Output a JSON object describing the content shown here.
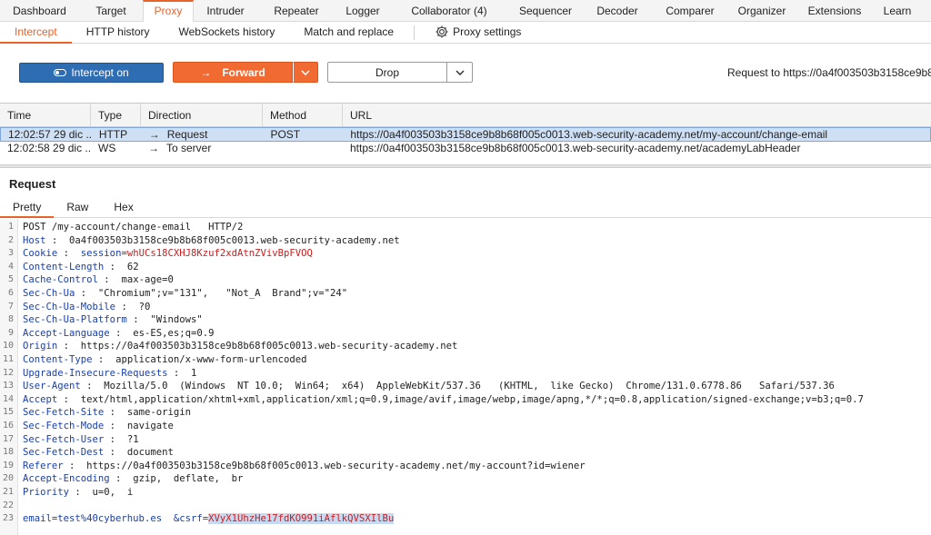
{
  "top_tabs": [
    "Dashboard",
    "Target",
    "Proxy",
    "Intruder",
    "Repeater",
    "Logger",
    "Collaborator (4)",
    "Sequencer",
    "Decoder",
    "Comparer",
    "Organizer",
    "Extensions",
    "Learn"
  ],
  "top_active": "Proxy",
  "sub_tabs": [
    "Intercept",
    "HTTP history",
    "WebSockets history",
    "Match and replace"
  ],
  "proxy_settings_label": "Proxy settings",
  "toolbar": {
    "intercept_label": "Intercept on",
    "forward_label": "Forward",
    "drop_label": "Drop",
    "request_to": "Request to https://0a4f003503b3158ce9b8"
  },
  "table": {
    "headers": [
      "Time",
      "Type",
      "Direction",
      "Method",
      "URL"
    ],
    "rows": [
      {
        "time": "12:02:57 29 dic ...",
        "type": "HTTP",
        "direction": "Request",
        "method": "POST",
        "url": "https://0a4f003503b3158ce9b8b68f005c0013.web-security-academy.net/my-account/change-email",
        "selected": true
      },
      {
        "time": "12:02:58 29 dic ...",
        "type": "WS",
        "direction": "To server",
        "method": "",
        "url": "https://0a4f003503b3158ce9b8b68f005c0013.web-security-academy.net/academyLabHeader",
        "selected": false
      }
    ]
  },
  "request": {
    "title": "Request",
    "tabs": [
      "Pretty",
      "Raw",
      "Hex"
    ],
    "lines": [
      {
        "n": "1",
        "k": "POST /my-account/change-email   HTTP/2",
        "v": "",
        "kind": "plain"
      },
      {
        "n": "2",
        "k": "Host",
        "v": "0a4f003503b3158ce9b8b68f005c0013.web-security-academy.net",
        "kind": "header"
      },
      {
        "n": "3",
        "k": "Cookie",
        "v": "session=whUCs18CXHJ8Kzuf2xdAtnZVivBpFVOQ",
        "kind": "cookie"
      },
      {
        "n": "4",
        "k": "Content-Length",
        "v": "62",
        "kind": "header"
      },
      {
        "n": "5",
        "k": "Cache-Control",
        "v": "max-age=0",
        "kind": "header"
      },
      {
        "n": "6",
        "k": "Sec-Ch-Ua",
        "v": "\"Chromium\";v=\"131\",   \"Not_A  Brand\";v=\"24\"",
        "kind": "header"
      },
      {
        "n": "7",
        "k": "Sec-Ch-Ua-Mobile",
        "v": "?0",
        "kind": "header"
      },
      {
        "n": "8",
        "k": "Sec-Ch-Ua-Platform",
        "v": "\"Windows\"",
        "kind": "header"
      },
      {
        "n": "9",
        "k": "Accept-Language",
        "v": "es-ES,es;q=0.9",
        "kind": "header"
      },
      {
        "n": "10",
        "k": "Origin",
        "v": "https://0a4f003503b3158ce9b8b68f005c0013.web-security-academy.net",
        "kind": "header"
      },
      {
        "n": "11",
        "k": "Content-Type",
        "v": "application/x-www-form-urlencoded",
        "kind": "header"
      },
      {
        "n": "12",
        "k": "Upgrade-Insecure-Requests",
        "v": "1",
        "kind": "header"
      },
      {
        "n": "13",
        "k": "User-Agent",
        "v": "Mozilla/5.0  (Windows  NT 10.0;  Win64;  x64)  AppleWebKit/537.36   (KHTML,  like Gecko)  Chrome/131.0.6778.86   Safari/537.36",
        "kind": "header"
      },
      {
        "n": "14",
        "k": "Accept",
        "v": "text/html,application/xhtml+xml,application/xml;q=0.9,image/avif,image/webp,image/apng,*/*;q=0.8,application/signed-exchange;v=b3;q=0.7",
        "kind": "header"
      },
      {
        "n": "15",
        "k": "Sec-Fetch-Site",
        "v": "same-origin",
        "kind": "header"
      },
      {
        "n": "16",
        "k": "Sec-Fetch-Mode",
        "v": "navigate",
        "kind": "header"
      },
      {
        "n": "17",
        "k": "Sec-Fetch-User",
        "v": "?1",
        "kind": "header"
      },
      {
        "n": "18",
        "k": "Sec-Fetch-Dest",
        "v": "document",
        "kind": "header"
      },
      {
        "n": "19",
        "k": "Referer",
        "v": "https://0a4f003503b3158ce9b8b68f005c0013.web-security-academy.net/my-account?id=wiener",
        "kind": "header"
      },
      {
        "n": "20",
        "k": "Accept-Encoding",
        "v": "gzip,  deflate,  br",
        "kind": "header"
      },
      {
        "n": "21",
        "k": "Priority",
        "v": "u=0,  i",
        "kind": "header"
      },
      {
        "n": "22",
        "k": "",
        "v": "",
        "kind": "plain"
      },
      {
        "n": "23",
        "k": "email=test%40cyberhub.es  &csrf=",
        "v": "XVyX1UhzHe17fdKO991iAflkQVSXIlBu",
        "kind": "body"
      }
    ]
  }
}
